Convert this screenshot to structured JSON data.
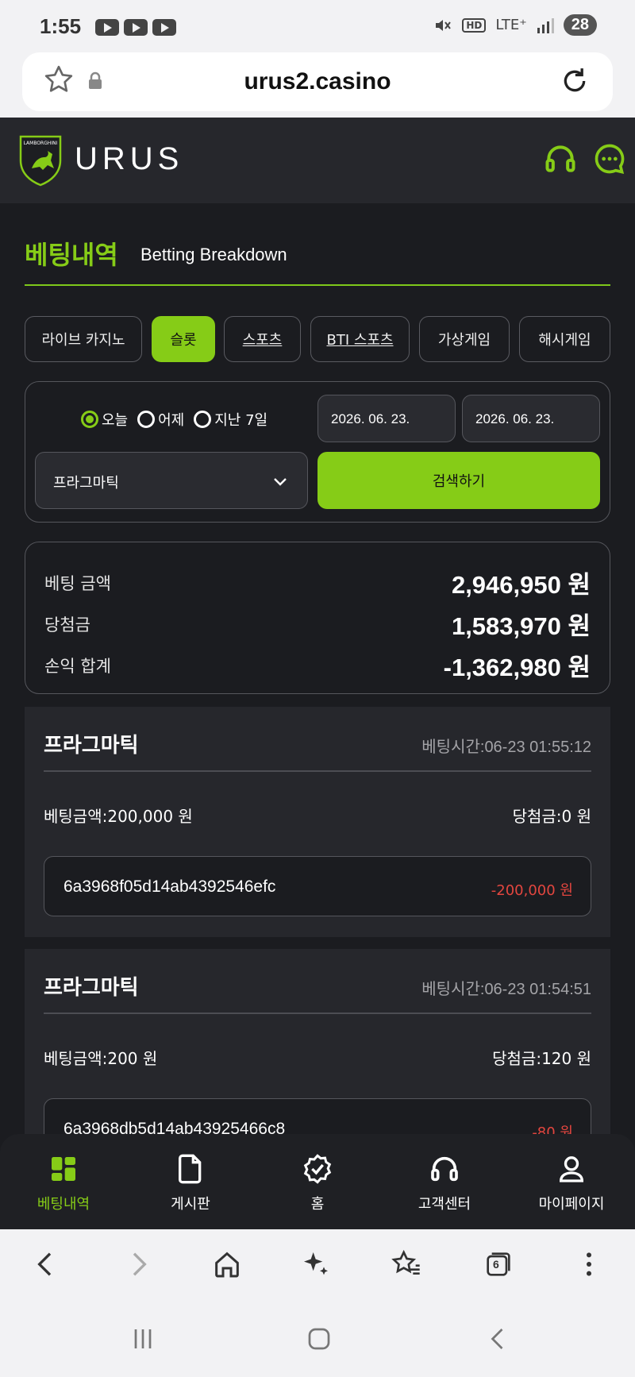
{
  "status_bar": {
    "time": "1:55",
    "lte": "LTE⁺",
    "hd": "HD",
    "battery": "28"
  },
  "browser": {
    "url": "urus2.casino"
  },
  "header": {
    "brand": "URUS",
    "logo_text": "LAMBORGHINI"
  },
  "page": {
    "title_ko": "베팅내역",
    "title_en": "Betting Breakdown"
  },
  "tabs": [
    {
      "label": "라이브 카지노"
    },
    {
      "label": "슬롯"
    },
    {
      "label": "스포츠"
    },
    {
      "label": "BTI 스포츠"
    },
    {
      "label": "가상게임"
    },
    {
      "label": "해시게임"
    }
  ],
  "filter": {
    "periods": [
      {
        "label": "오늘"
      },
      {
        "label": "어제"
      },
      {
        "label": "지난 7일"
      }
    ],
    "date_from": "2026. 06. 23.",
    "date_to": "2026. 06. 23.",
    "provider": "프라그마틱",
    "search_label": "검색하기"
  },
  "summary": {
    "bet_label": "베팅 금액",
    "bet_value": "2,946,950 원",
    "win_label": "당첨금",
    "win_value": "1,583,970 원",
    "pnl_label": "손익 합계",
    "pnl_value": "-1,362,980 원"
  },
  "bets": [
    {
      "game": "프라그마틱",
      "time": "베팅시간:06-23 01:55:12",
      "bet_amount": "베팅금액:200,000 원",
      "win_amount": "당첨금:0 원",
      "tx_id": "6a3968f05d14ab4392546efc",
      "pnl": "-200,000 원"
    },
    {
      "game": "프라그마틱",
      "time": "베팅시간:06-23 01:54:51",
      "bet_amount": "베팅금액:200 원",
      "win_amount": "당첨금:120 원",
      "tx_id": "6a3968db5d14ab43925466c8",
      "pnl": "-80 원"
    }
  ],
  "app_nav": [
    {
      "label": "베팅내역",
      "icon": "betting-history-icon"
    },
    {
      "label": "게시판",
      "icon": "document-icon"
    },
    {
      "label": "홈",
      "icon": "badge-check-icon"
    },
    {
      "label": "고객센터",
      "icon": "headset-icon"
    },
    {
      "label": "마이페이지",
      "icon": "user-icon"
    }
  ],
  "browser_toolbar": {
    "tab_count": "6"
  },
  "colors": {
    "accent": "#86cc17",
    "negative": "#e3463f",
    "background": "#1b1c20",
    "panel": "#26272c"
  }
}
